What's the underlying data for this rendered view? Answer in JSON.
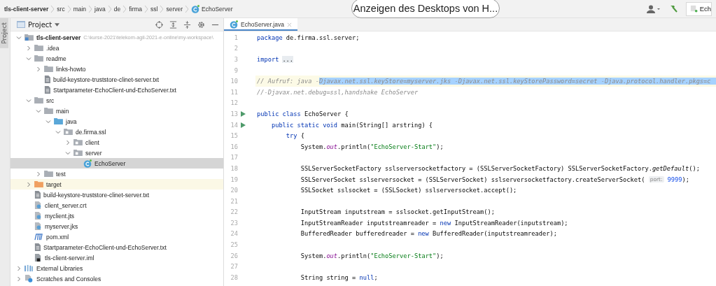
{
  "breadcrumb": [
    {
      "label": "tls-client-server",
      "kind": "project"
    },
    {
      "label": "src",
      "kind": "folder"
    },
    {
      "label": "main",
      "kind": "folder"
    },
    {
      "label": "java",
      "kind": "folder"
    },
    {
      "label": "de",
      "kind": "folder"
    },
    {
      "label": "firma",
      "kind": "folder"
    },
    {
      "label": "ssl",
      "kind": "folder"
    },
    {
      "label": "server",
      "kind": "folder"
    },
    {
      "label": "EchoServer",
      "kind": "class"
    }
  ],
  "desktop_popup": {
    "label": "Anzeigen des Desktops von H..."
  },
  "toolbar": {
    "run_config": "Ech"
  },
  "side_tab": {
    "label": "Project",
    "selected": true
  },
  "project_panel": {
    "title": "Project",
    "tree": [
      {
        "label": "tls-client-server",
        "path": "C:\\kurse-2021\\telekom-agil-2021-e-online\\my-workspace\\",
        "kind": "project",
        "expanded": true,
        "selected": false,
        "children": [
          {
            "label": ".idea",
            "kind": "folder",
            "expanded": false,
            "selected": false
          },
          {
            "label": "readme",
            "kind": "folder",
            "expanded": true,
            "selected": false,
            "children": [
              {
                "label": "links-howto",
                "kind": "folder",
                "expanded": false,
                "selected": false
              },
              {
                "label": "build-keystore-truststore-clinet-server.txt",
                "kind": "text",
                "selected": false
              },
              {
                "label": "Startparameter-EchoClient-und-EchoServer.txt",
                "kind": "text",
                "selected": false
              }
            ]
          },
          {
            "label": "src",
            "kind": "folder",
            "expanded": true,
            "selected": false,
            "children": [
              {
                "label": "main",
                "kind": "folder",
                "expanded": true,
                "selected": false,
                "children": [
                  {
                    "label": "java",
                    "kind": "source",
                    "expanded": true,
                    "selected": false,
                    "children": [
                      {
                        "label": "de.firma.ssl",
                        "kind": "package",
                        "expanded": true,
                        "selected": false,
                        "children": [
                          {
                            "label": "client",
                            "kind": "package",
                            "expanded": false,
                            "selected": false
                          },
                          {
                            "label": "server",
                            "kind": "package",
                            "expanded": true,
                            "selected": false,
                            "children": [
                              {
                                "label": "EchoServer",
                                "kind": "class",
                                "selected": true
                              }
                            ]
                          }
                        ]
                      }
                    ]
                  }
                ]
              },
              {
                "label": "test",
                "kind": "folder",
                "expanded": false,
                "selected": false
              }
            ]
          },
          {
            "label": "target",
            "kind": "excluded",
            "expanded": false,
            "selected": false
          },
          {
            "label": "build-keystore-truststore-clinet-server.txt",
            "kind": "text",
            "selected": false
          },
          {
            "label": "client_server.crt",
            "kind": "cert",
            "selected": false
          },
          {
            "label": "myclient.jts",
            "kind": "cert",
            "selected": false
          },
          {
            "label": "myserver.jks",
            "kind": "cert",
            "selected": false
          },
          {
            "label": "pom.xml",
            "kind": "maven",
            "selected": false
          },
          {
            "label": "Startparameter-EchoClient-und-EchoServer.txt",
            "kind": "text",
            "selected": false
          },
          {
            "label": "tls-client-server.iml",
            "kind": "iml",
            "selected": false
          }
        ]
      },
      {
        "label": "External Libraries",
        "kind": "libraries",
        "expanded": false,
        "selected": false
      },
      {
        "label": "Scratches and Consoles",
        "kind": "scratches",
        "expanded": false,
        "selected": false
      }
    ]
  },
  "editor": {
    "tabs": [
      {
        "label": "EchoServer.java",
        "selected": true
      }
    ],
    "lines": [
      {
        "number": "1",
        "current": false,
        "run": false,
        "segments": [
          {
            "kind": "keyword",
            "text": "package"
          },
          {
            "kind": "plain",
            "text": " de.firma.ssl.server;"
          }
        ]
      },
      {
        "number": "2",
        "current": false,
        "run": false
      },
      {
        "number": "3",
        "current": false,
        "run": false,
        "segments": [
          {
            "kind": "keyword",
            "text": "import"
          },
          {
            "kind": "folded",
            "text": "..."
          }
        ]
      },
      {
        "number": "9",
        "current": false,
        "run": false
      },
      {
        "number": "10",
        "current": true,
        "run": false,
        "segments": [
          {
            "kind": "comment",
            "text": "// Aufruf: java -"
          },
          {
            "kind": "selected",
            "text": "Djavax.net.ssl.keyStore=myserver.jks -Djavax.net.ssl.keyStorePassword=secret -Djava.protocol.handler.pkgs=c"
          }
        ]
      },
      {
        "number": "11",
        "current": false,
        "run": false,
        "segments": [
          {
            "kind": "comment",
            "text": "//-Djavax.net.debug=ssl,handshake EchoServer"
          }
        ]
      },
      {
        "number": "12",
        "current": false,
        "run": false
      },
      {
        "number": "13",
        "current": false,
        "run": true,
        "segments": [
          {
            "kind": "keyword",
            "text": "public class"
          },
          {
            "kind": "plain",
            "text": " EchoServer {"
          }
        ]
      },
      {
        "number": "14",
        "current": false,
        "run": true,
        "segments": [
          {
            "kind": "keyword",
            "text": "    public static void"
          },
          {
            "kind": "plain",
            "text": " main(String[] arstring) {"
          }
        ]
      },
      {
        "number": "15",
        "current": false,
        "run": false,
        "segments": [
          {
            "kind": "keyword",
            "text": "        try"
          },
          {
            "kind": "plain",
            "text": " {"
          }
        ]
      },
      {
        "number": "16",
        "current": false,
        "run": false,
        "segments": [
          {
            "kind": "plain",
            "text": "            System."
          },
          {
            "kind": "static",
            "text": "out"
          },
          {
            "kind": "plain",
            "text": ".println("
          },
          {
            "kind": "string",
            "text": "\"EchoServer-Start\""
          },
          {
            "kind": "plain",
            "text": ");"
          }
        ]
      },
      {
        "number": "17",
        "current": false,
        "run": false
      },
      {
        "number": "18",
        "current": false,
        "run": false,
        "segments": [
          {
            "kind": "plain",
            "text": "            SSLServerSocketFactory sslserversocketfactory = (SSLServerSocketFactory) SSLServerSocketFactory."
          },
          {
            "kind": "italic",
            "text": "getDefault"
          },
          {
            "kind": "plain",
            "text": "();"
          }
        ]
      },
      {
        "number": "19",
        "current": false,
        "run": false,
        "segments": [
          {
            "kind": "plain",
            "text": "            SSLServerSocket sslserversocket = (SSLServerSocket) sslserversocketfactory.createServerSocket( "
          },
          {
            "kind": "hint",
            "text": "port:"
          },
          {
            "kind": "number",
            "text": "9999"
          },
          {
            "kind": "plain",
            "text": ");"
          }
        ]
      },
      {
        "number": "20",
        "current": false,
        "run": false,
        "segments": [
          {
            "kind": "plain",
            "text": "            SSLSocket sslsocket = (SSLSocket) sslserversocket.accept();"
          }
        ]
      },
      {
        "number": "21",
        "current": false,
        "run": false
      },
      {
        "number": "22",
        "current": false,
        "run": false,
        "segments": [
          {
            "kind": "plain",
            "text": "            InputStream inputstream = sslsocket.getInputStream();"
          }
        ]
      },
      {
        "number": "23",
        "current": false,
        "run": false,
        "segments": [
          {
            "kind": "plain",
            "text": "            InputStreamReader inputstreamreader = "
          },
          {
            "kind": "keyword",
            "text": "new"
          },
          {
            "kind": "plain",
            "text": " InputStreamReader(inputstream);"
          }
        ]
      },
      {
        "number": "24",
        "current": false,
        "run": false,
        "segments": [
          {
            "kind": "plain",
            "text": "            BufferedReader bufferedreader = "
          },
          {
            "kind": "keyword",
            "text": "new"
          },
          {
            "kind": "plain",
            "text": " BufferedReader(inputstreamreader);"
          }
        ]
      },
      {
        "number": "25",
        "current": false,
        "run": false
      },
      {
        "number": "26",
        "current": false,
        "run": false,
        "segments": [
          {
            "kind": "plain",
            "text": "            System."
          },
          {
            "kind": "static",
            "text": "out"
          },
          {
            "kind": "plain",
            "text": ".println("
          },
          {
            "kind": "string",
            "text": "\"EchoServer-Start\""
          },
          {
            "kind": "plain",
            "text": ");"
          }
        ]
      },
      {
        "number": "27",
        "current": false,
        "run": false
      },
      {
        "number": "28",
        "current": false,
        "run": false,
        "segments": [
          {
            "kind": "plain",
            "text": "            String string = "
          },
          {
            "kind": "keyword",
            "text": "null"
          },
          {
            "kind": "plain",
            "text": ";"
          }
        ]
      }
    ]
  }
}
